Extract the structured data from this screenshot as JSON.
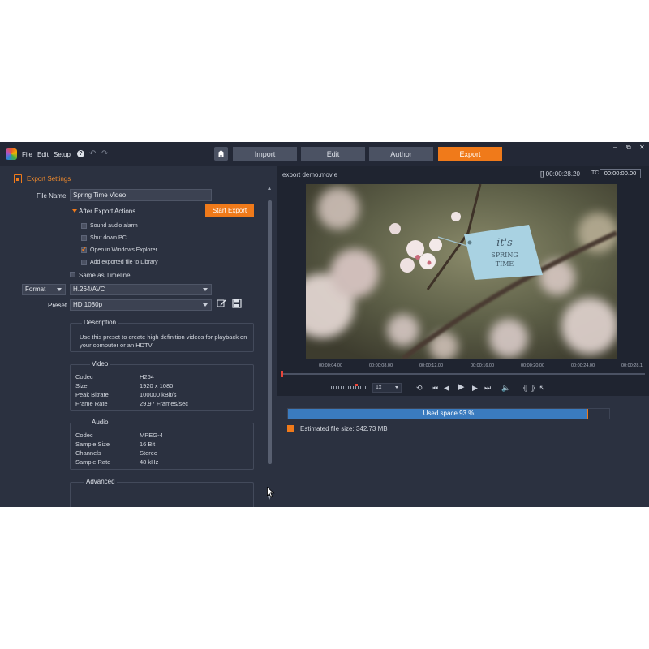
{
  "menu": {
    "file": "File",
    "edit": "Edit",
    "setup": "Setup",
    "help": "?"
  },
  "tabs": [
    {
      "label": "Import",
      "active": false
    },
    {
      "label": "Edit",
      "active": false
    },
    {
      "label": "Author",
      "active": false
    },
    {
      "label": "Export",
      "active": true
    }
  ],
  "window_controls": {
    "minimize": "–",
    "restore": "⧉",
    "close": "✕"
  },
  "export_settings": {
    "title": "Export Settings",
    "file_name_label": "File Name",
    "file_name_value": "Spring Time Video",
    "after_export_label": "After Export Actions",
    "start_export": "Start Export",
    "options": [
      {
        "label": "Sound audio alarm",
        "checked": false
      },
      {
        "label": "Shut down PC",
        "checked": false
      },
      {
        "label": "Open in Windows Explorer",
        "checked": true
      },
      {
        "label": "Add exported file to Library",
        "checked": false
      }
    ],
    "same_as_timeline": {
      "label": "Same as Timeline",
      "checked": false
    },
    "format_label": "Format",
    "format_value": "H.264/AVC",
    "preset_label": "Preset",
    "preset_value": "HD 1080p",
    "description_title": "Description",
    "description_text": "Use this preset to create high definition videos for playback on your computer or an HDTV",
    "video_title": "Video",
    "video": [
      {
        "key": "Codec",
        "value": "H264"
      },
      {
        "key": "Size",
        "value": "1920 x 1080"
      },
      {
        "key": "Peak Bitrate",
        "value": "100000 kBit/s"
      },
      {
        "key": "Frame Rate",
        "value": "29.97 Frames/sec"
      }
    ],
    "audio_title": "Audio",
    "audio": [
      {
        "key": "Codec",
        "value": "MPEG-4"
      },
      {
        "key": "Sample Size",
        "value": "16 Bit"
      },
      {
        "key": "Channels",
        "value": "Stereo"
      },
      {
        "key": "Sample Rate",
        "value": "48 kHz"
      }
    ],
    "advanced_title": "Advanced"
  },
  "preview": {
    "title": "export demo.movie",
    "duration": "[] 00:00:28.20",
    "tc_label": "TC",
    "tc_value": "00:00:00.00",
    "tag_text_line1": "it's",
    "tag_text_line2": "SPRING",
    "tag_text_line3": "TIME",
    "ruler": [
      "00;00;04.00",
      "00;00;08.00",
      "00;00;12.00",
      "00;00;16.00",
      "00;00;20.00",
      "00;00;24.00",
      "00;00;28.1"
    ],
    "speed": "1x"
  },
  "storage": {
    "used_label": "Used space 93 %",
    "used_fraction": 0.93,
    "estimate": "Estimated file size: 342.73 MB"
  },
  "colors": {
    "accent": "#f07a1a",
    "usage_fill": "#3a7bbf",
    "background": "#2b3140"
  }
}
